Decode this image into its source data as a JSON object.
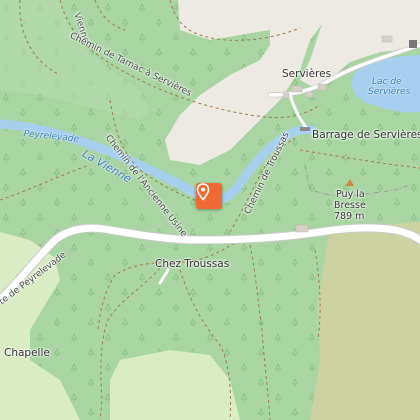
{
  "map": {
    "colors": {
      "forest": "#a8d5a2",
      "meadow": "#d9ecc4",
      "urban": "#ede9e3",
      "water": "#a6d0ee",
      "field": "#ccd3a1",
      "road": "#ffffff",
      "path": "#a17a48",
      "marker": "#ef6b33",
      "peak": "#d9823b"
    },
    "labels": {
      "chemin_tarnac": "Chemin de Tarnac à Servières",
      "servieres": "Servières",
      "lac_servieres_line1": "Lac de",
      "lac_servieres_line2": "Servières",
      "peyrelevade_water": "Peyrelevade",
      "la_vienne": "La Vienne",
      "chemin_ancienne_usine": "Chemin de l'Ancienne Usine",
      "chemin_troussas": "Chemin de Troussas",
      "barrage": "Barrage de Servières",
      "peak_name_line1": "Puy la",
      "peak_name_line2": "Bresse",
      "peak_elevation": "789 m",
      "chez_troussas": "Chez Troussas",
      "route_peyrelevade": "te de Peyrelevade",
      "chapelle": "Chapelle",
      "top_vienne_fragment": "Vienne"
    },
    "marker": {
      "icon": "map-pin-icon"
    },
    "icons": {
      "peak": "peak-triangle-icon",
      "forest": "tree-icon"
    }
  }
}
